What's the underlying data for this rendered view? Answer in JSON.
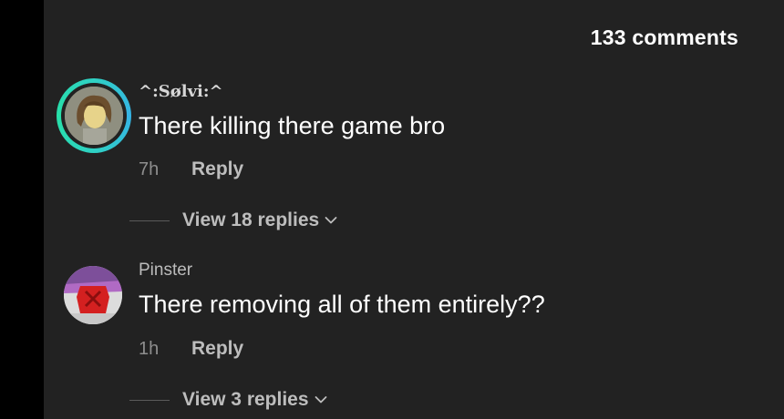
{
  "header": {
    "comment_count": "133 comments"
  },
  "comments": [
    {
      "username": "^:Sølvi:^",
      "text": "There killing there game bro",
      "timestamp": "7h",
      "reply_label": "Reply",
      "view_replies_label": "View 18 replies",
      "avatar_has_story_ring": true
    },
    {
      "username": "Pinster",
      "text": "There removing all of them entirely??",
      "timestamp": "1h",
      "reply_label": "Reply",
      "view_replies_label": "View 3 replies",
      "avatar_has_story_ring": false
    }
  ],
  "icons": {
    "expand_replies": "chevron-down-icon"
  },
  "colors": {
    "background": "#222222",
    "story_ring": "#2fd1c4",
    "primary_text": "#ffffff",
    "secondary_text": "#bdbdbd"
  }
}
